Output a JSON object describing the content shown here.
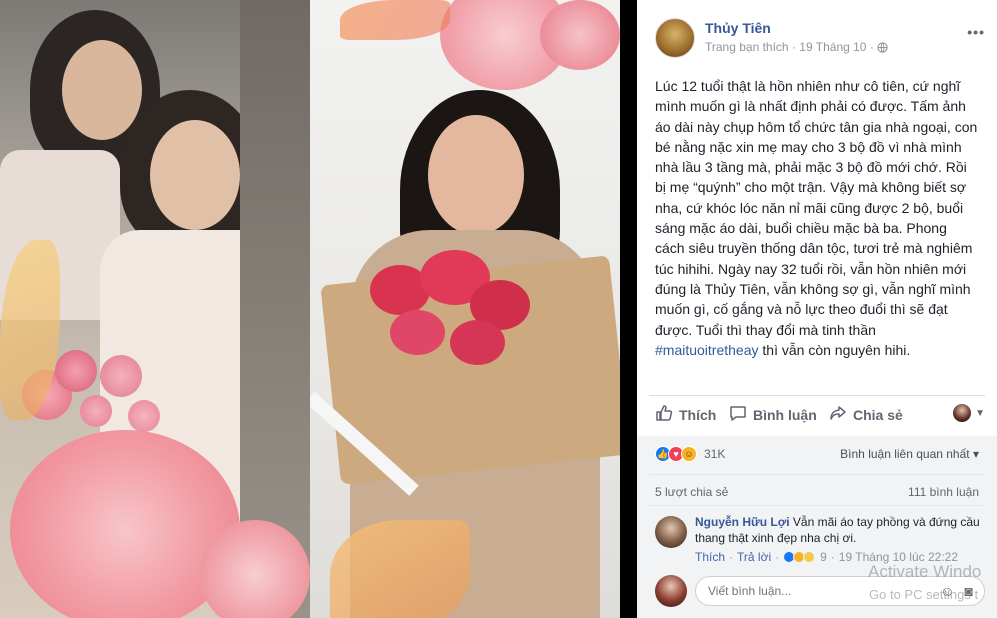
{
  "post": {
    "author": "Thủy Tiên",
    "meta_source": "Trang bạn thích",
    "meta_sep": "·",
    "meta_date": "19 Tháng 10",
    "meta_sep2": "·",
    "privacy_icon": "globe-icon",
    "more_label": "•••",
    "text_lines": [
      "Lúc 12 tuổi thật là hồn nhiên như cô tiên, cứ nghĩ",
      "mình muốn gì là nhất định phải có được. Tấm ảnh",
      "áo dài này chụp hôm tổ chức tân gia nhà ngoại, con",
      "bé nằng nặc xin mẹ may cho 3 bộ đồ vì nhà mình",
      "nhà lầu 3 tầng mà, phải mặc 3 bộ đồ mới chớ. Rồi",
      "bị mẹ “quýnh” cho một trận. Vậy mà không biết sợ",
      "nha, cứ khóc lóc năn nỉ mãi cũng được 2 bộ, buổi",
      "sáng mặc áo dài, buổi chiều mặc bà ba. Phong",
      "cách siêu truyền thống dân tộc, tươi trẻ mà nghiêm",
      "túc hihihi. Ngày nay 32 tuổi rồi, vẫn hồn nhiên mới",
      "đúng là Thủy Tiên, vẫn không sợ gì, vẫn nghĩ mình",
      "muốn gì, cố gắng và nỗ lực theo đuổi thì sẽ đạt",
      "được. Tuổi thì thay đổi mà tinh thần"
    ],
    "hashtag": "#maituoitretheay",
    "text_last": " thì vẫn còn nguyên hihi."
  },
  "actions": {
    "like": "Thích",
    "comment": "Bình luận",
    "share": "Chia sẻ"
  },
  "reactions": {
    "count": "31K",
    "sort_label": "Bình luận liên quan nhất",
    "sort_caret": "▾",
    "shares": "5 lượt chia sẻ",
    "comments": "111 bình luận"
  },
  "comment": {
    "name": "Nguyễn Hữu Lợi",
    "text": " Vẫn mãi áo tay phồng và đứng cầu thang thật xinh đẹp nha chị ơi.",
    "like": "Thích",
    "dot": "·",
    "reply": "Trả lời",
    "dot2": "·",
    "reaction_count": "9",
    "dot3": "·",
    "time": "19 Tháng 10 lúc 22:22"
  },
  "write": {
    "placeholder": "Viết bình luận..."
  },
  "watermark": {
    "title": "Activate Windo",
    "subtitle": "Go to PC settings t"
  },
  "colors": {
    "link": "#365899",
    "text": "#1d2129",
    "muted": "#90949c"
  }
}
